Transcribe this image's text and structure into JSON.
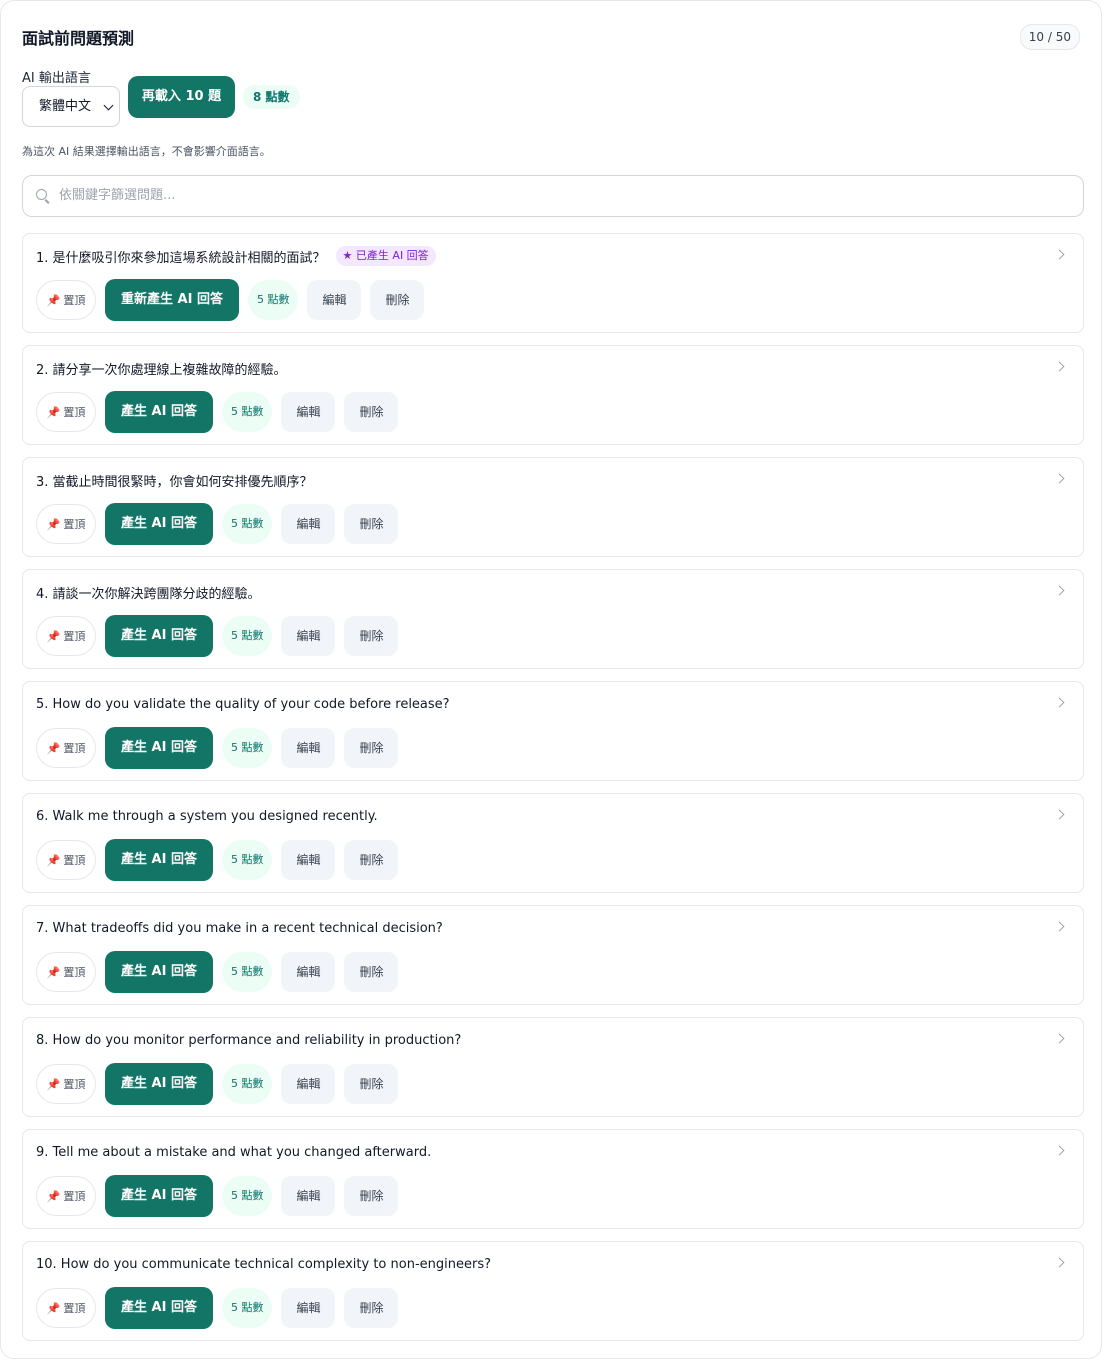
{
  "header": {
    "title": "面試前問題預測",
    "counter": "10 / 50"
  },
  "language": {
    "label": "AI 輸出語言",
    "selected": "繁體中文",
    "hint": "為這次 AI 結果選擇輸出語言，不會影響介面語言。"
  },
  "reload": {
    "label": "再載入 10 題",
    "cost": "8 點數"
  },
  "search": {
    "placeholder": "依關鍵字篩選問題..."
  },
  "questions": [
    {
      "text": "1. 是什麼吸引你來參加這場系統設計相關的面試？",
      "badge": "已產生 AI 回答",
      "generate_label": "重新產生 AI 回答"
    },
    {
      "text": "2. 請分享一次你處理線上複雜故障的經驗。",
      "badge": "",
      "generate_label": "產生 AI 回答"
    },
    {
      "text": "3. 當截止時間很緊時，你會如何安排優先順序？",
      "badge": "",
      "generate_label": "產生 AI 回答"
    },
    {
      "text": "4. 請談一次你解決跨團隊分歧的經驗。",
      "badge": "",
      "generate_label": "產生 AI 回答"
    },
    {
      "text": "5. How do you validate the quality of your code before release?",
      "badge": "",
      "generate_label": "產生 AI 回答"
    },
    {
      "text": "6. Walk me through a system you designed recently.",
      "badge": "",
      "generate_label": "產生 AI 回答"
    },
    {
      "text": "7. What tradeoffs did you make in a recent technical decision?",
      "badge": "",
      "generate_label": "產生 AI 回答"
    },
    {
      "text": "8. How do you monitor performance and reliability in production?",
      "badge": "",
      "generate_label": "產生 AI 回答"
    },
    {
      "text": "9. Tell me about a mistake and what you changed afterward.",
      "badge": "",
      "generate_label": "產生 AI 回答"
    },
    {
      "text": "10. How do you communicate technical complexity to non-engineers?",
      "badge": "",
      "generate_label": "產生 AI 回答"
    }
  ],
  "actions": {
    "pin_icon": "📌",
    "pin_label": "置頂",
    "cost_label": "5 點數",
    "edit_label": "編輯",
    "delete_label": "刪除",
    "badge_star": "★"
  },
  "colors": {
    "primary": "#137566",
    "cost_bg": "#ecfdf5",
    "badge_bg": "#f3e8ff",
    "badge_text": "#7e22ce"
  }
}
